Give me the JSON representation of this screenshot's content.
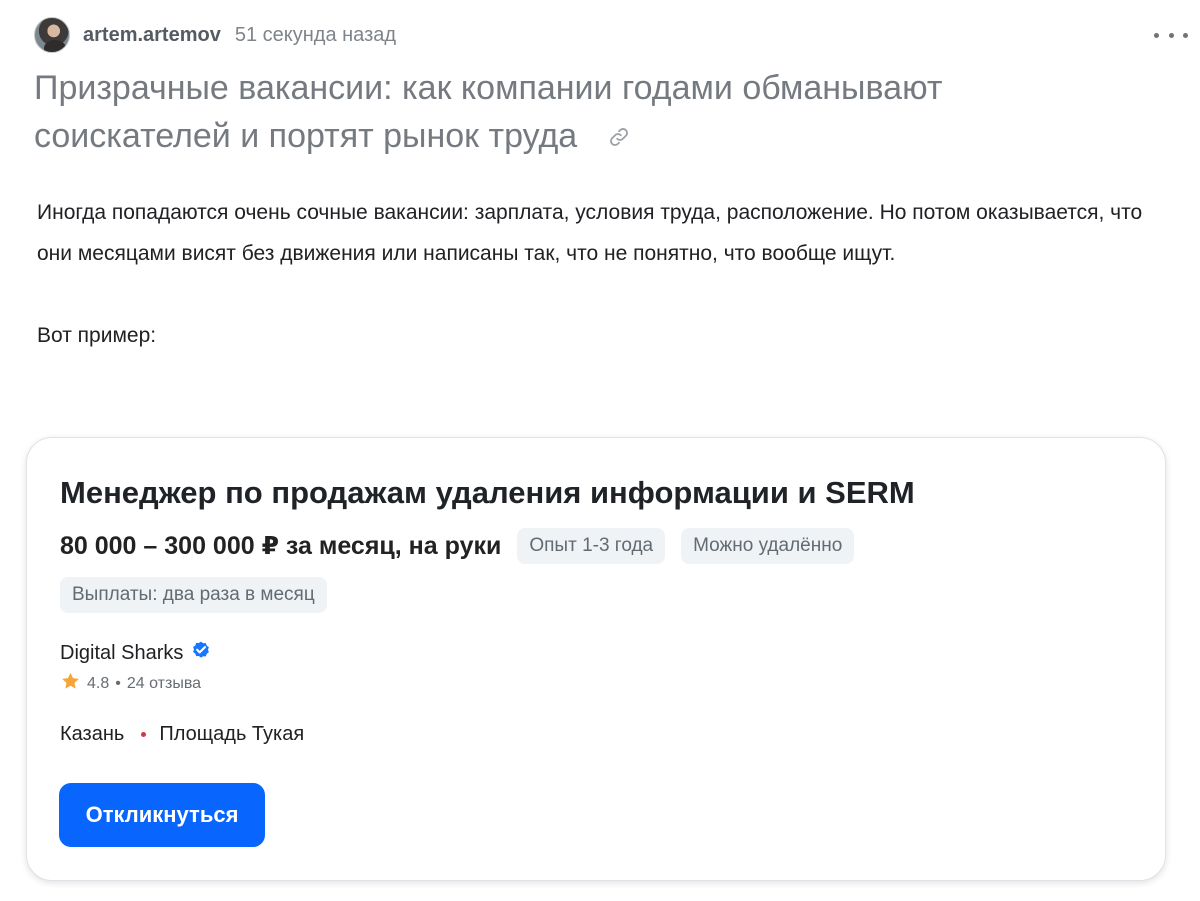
{
  "post": {
    "author": "artem.artemov",
    "timestamp": "51 секунда назад",
    "title": "Призрачные вакансии: как компании годами обманывают соискателей и портят рынок труда",
    "body": "Иногда попадаются очень сочные вакансии: зарплата, условия труда, расположение. Но потом оказывается, что они месяцами висят без движения или написаны так, что не понятно, что вообще ищут.",
    "example_label": "Вот пример:"
  },
  "job_card": {
    "title": "Менеджер по продажам удаления информации и SERM",
    "salary": "80 000 – 300 000 ₽ за месяц, на руки",
    "tags": [
      "Опыт 1-3 года",
      "Можно удалённо",
      "Выплаты: два раза в месяц"
    ],
    "company": "Digital Sharks",
    "rating": "4.8",
    "separator": "•",
    "reviews": "24 отзыва",
    "city": "Казань",
    "metro": "Площадь Тукая",
    "apply_label": "Откликнуться"
  },
  "colors": {
    "accent": "#0866ff",
    "verified": "#1677ff",
    "star": "#f4a63a",
    "metro": "#d4364c"
  },
  "icons": {
    "avatar": "user-avatar",
    "more": "more-horizontal-icon",
    "link": "link-icon",
    "verified": "verified-badge-icon",
    "rating": "star-icon"
  }
}
